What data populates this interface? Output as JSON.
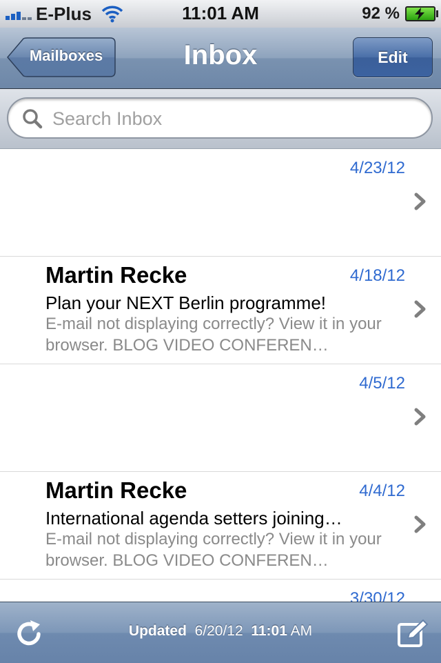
{
  "status_bar": {
    "carrier": "E-Plus",
    "time": "11:01 AM",
    "battery_percent": "92 %"
  },
  "nav": {
    "back_label": "Mailboxes",
    "title": "Inbox",
    "edit_label": "Edit"
  },
  "search": {
    "placeholder": "Search Inbox",
    "value": ""
  },
  "messages": [
    {
      "sender": "",
      "date": "4/23/12",
      "subject": "",
      "preview": ""
    },
    {
      "sender": "Martin Recke",
      "date": "4/18/12",
      "subject": "Plan your NEXT Berlin programme!",
      "preview": "E-mail not displaying correctly? View it in your browser. BLOG VIDEO CONFEREN…"
    },
    {
      "sender": "",
      "date": "4/5/12",
      "subject": "",
      "preview": ""
    },
    {
      "sender": "Martin Recke",
      "date": "4/4/12",
      "subject": "International agenda setters joining…",
      "preview": "E-mail not displaying correctly? View it in your browser. BLOG VIDEO CONFEREN…"
    },
    {
      "sender": "",
      "date": "3/30/12",
      "subject": "",
      "preview": ""
    }
  ],
  "toolbar": {
    "updated_label": "Updated",
    "updated_date": "6/20/12",
    "updated_time": "11:01",
    "updated_ampm": "AM"
  },
  "colors": {
    "date_blue": "#2f6ad0",
    "nav_blue": "#7a92b0",
    "edit_blue": "#3b5f9a"
  }
}
